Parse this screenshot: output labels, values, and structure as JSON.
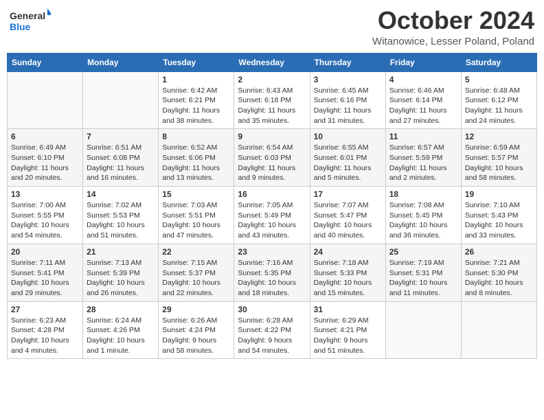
{
  "header": {
    "logo_general": "General",
    "logo_blue": "Blue",
    "month": "October 2024",
    "location": "Witanowice, Lesser Poland, Poland"
  },
  "days_of_week": [
    "Sunday",
    "Monday",
    "Tuesday",
    "Wednesday",
    "Thursday",
    "Friday",
    "Saturday"
  ],
  "weeks": [
    [
      {
        "day": "",
        "info": ""
      },
      {
        "day": "",
        "info": ""
      },
      {
        "day": "1",
        "info": "Sunrise: 6:42 AM\nSunset: 6:21 PM\nDaylight: 11 hours and 38 minutes."
      },
      {
        "day": "2",
        "info": "Sunrise: 6:43 AM\nSunset: 6:18 PM\nDaylight: 11 hours and 35 minutes."
      },
      {
        "day": "3",
        "info": "Sunrise: 6:45 AM\nSunset: 6:16 PM\nDaylight: 11 hours and 31 minutes."
      },
      {
        "day": "4",
        "info": "Sunrise: 6:46 AM\nSunset: 6:14 PM\nDaylight: 11 hours and 27 minutes."
      },
      {
        "day": "5",
        "info": "Sunrise: 6:48 AM\nSunset: 6:12 PM\nDaylight: 11 hours and 24 minutes."
      }
    ],
    [
      {
        "day": "6",
        "info": "Sunrise: 6:49 AM\nSunset: 6:10 PM\nDaylight: 11 hours and 20 minutes."
      },
      {
        "day": "7",
        "info": "Sunrise: 6:51 AM\nSunset: 6:08 PM\nDaylight: 11 hours and 16 minutes."
      },
      {
        "day": "8",
        "info": "Sunrise: 6:52 AM\nSunset: 6:06 PM\nDaylight: 11 hours and 13 minutes."
      },
      {
        "day": "9",
        "info": "Sunrise: 6:54 AM\nSunset: 6:03 PM\nDaylight: 11 hours and 9 minutes."
      },
      {
        "day": "10",
        "info": "Sunrise: 6:55 AM\nSunset: 6:01 PM\nDaylight: 11 hours and 5 minutes."
      },
      {
        "day": "11",
        "info": "Sunrise: 6:57 AM\nSunset: 5:59 PM\nDaylight: 11 hours and 2 minutes."
      },
      {
        "day": "12",
        "info": "Sunrise: 6:59 AM\nSunset: 5:57 PM\nDaylight: 10 hours and 58 minutes."
      }
    ],
    [
      {
        "day": "13",
        "info": "Sunrise: 7:00 AM\nSunset: 5:55 PM\nDaylight: 10 hours and 54 minutes."
      },
      {
        "day": "14",
        "info": "Sunrise: 7:02 AM\nSunset: 5:53 PM\nDaylight: 10 hours and 51 minutes."
      },
      {
        "day": "15",
        "info": "Sunrise: 7:03 AM\nSunset: 5:51 PM\nDaylight: 10 hours and 47 minutes."
      },
      {
        "day": "16",
        "info": "Sunrise: 7:05 AM\nSunset: 5:49 PM\nDaylight: 10 hours and 43 minutes."
      },
      {
        "day": "17",
        "info": "Sunrise: 7:07 AM\nSunset: 5:47 PM\nDaylight: 10 hours and 40 minutes."
      },
      {
        "day": "18",
        "info": "Sunrise: 7:08 AM\nSunset: 5:45 PM\nDaylight: 10 hours and 36 minutes."
      },
      {
        "day": "19",
        "info": "Sunrise: 7:10 AM\nSunset: 5:43 PM\nDaylight: 10 hours and 33 minutes."
      }
    ],
    [
      {
        "day": "20",
        "info": "Sunrise: 7:11 AM\nSunset: 5:41 PM\nDaylight: 10 hours and 29 minutes."
      },
      {
        "day": "21",
        "info": "Sunrise: 7:13 AM\nSunset: 5:39 PM\nDaylight: 10 hours and 26 minutes."
      },
      {
        "day": "22",
        "info": "Sunrise: 7:15 AM\nSunset: 5:37 PM\nDaylight: 10 hours and 22 minutes."
      },
      {
        "day": "23",
        "info": "Sunrise: 7:16 AM\nSunset: 5:35 PM\nDaylight: 10 hours and 18 minutes."
      },
      {
        "day": "24",
        "info": "Sunrise: 7:18 AM\nSunset: 5:33 PM\nDaylight: 10 hours and 15 minutes."
      },
      {
        "day": "25",
        "info": "Sunrise: 7:19 AM\nSunset: 5:31 PM\nDaylight: 10 hours and 11 minutes."
      },
      {
        "day": "26",
        "info": "Sunrise: 7:21 AM\nSunset: 5:30 PM\nDaylight: 10 hours and 8 minutes."
      }
    ],
    [
      {
        "day": "27",
        "info": "Sunrise: 6:23 AM\nSunset: 4:28 PM\nDaylight: 10 hours and 4 minutes."
      },
      {
        "day": "28",
        "info": "Sunrise: 6:24 AM\nSunset: 4:26 PM\nDaylight: 10 hours and 1 minute."
      },
      {
        "day": "29",
        "info": "Sunrise: 6:26 AM\nSunset: 4:24 PM\nDaylight: 9 hours and 58 minutes."
      },
      {
        "day": "30",
        "info": "Sunrise: 6:28 AM\nSunset: 4:22 PM\nDaylight: 9 hours and 54 minutes."
      },
      {
        "day": "31",
        "info": "Sunrise: 6:29 AM\nSunset: 4:21 PM\nDaylight: 9 hours and 51 minutes."
      },
      {
        "day": "",
        "info": ""
      },
      {
        "day": "",
        "info": ""
      }
    ]
  ]
}
